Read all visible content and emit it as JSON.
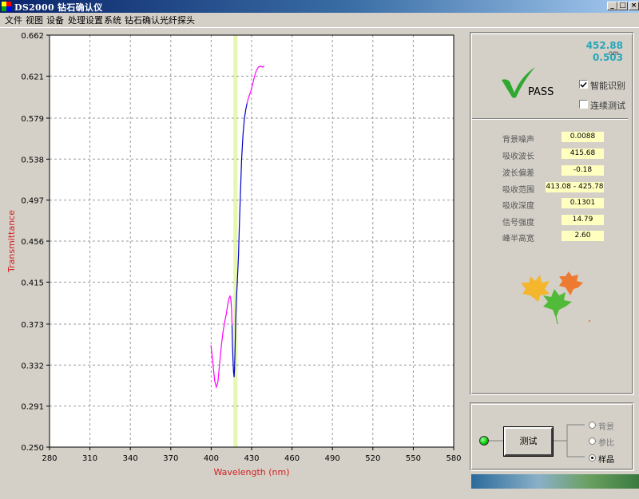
{
  "window": {
    "title": "DS2000 钻石确认仪",
    "controls": [
      "_",
      "□",
      "×"
    ]
  },
  "menu": [
    "文件",
    "视图",
    "设备",
    "处理设置",
    "系统",
    "钻石确认",
    "光纤探头"
  ],
  "chart_data": {
    "type": "line",
    "xlabel": "Wavelength (nm)",
    "ylabel": "Transmittance",
    "xlim": [
      280,
      580
    ],
    "ylim": [
      0.25,
      0.662
    ],
    "x_ticks": [
      "280",
      "310",
      "340",
      "370",
      "400",
      "430",
      "460",
      "490",
      "520",
      "550",
      "580"
    ],
    "y_ticks": [
      "0.662",
      "0.621",
      "0.579",
      "0.538",
      "0.497",
      "0.456",
      "0.415",
      "0.373",
      "0.332",
      "0.291",
      "0.250"
    ],
    "grid": true,
    "highlight_band": [
      416.5,
      419.5
    ],
    "series": [
      {
        "color": "#ff00ff",
        "points": [
          [
            399.8,
            0.352
          ],
          [
            401.2,
            0.335
          ],
          [
            402.6,
            0.316
          ],
          [
            403.8,
            0.31
          ],
          [
            405,
            0.315
          ],
          [
            406.2,
            0.333
          ],
          [
            407.6,
            0.352
          ],
          [
            408.8,
            0.365
          ],
          [
            410,
            0.375
          ],
          [
            411.2,
            0.383
          ],
          [
            412.2,
            0.392
          ],
          [
            413.2,
            0.399
          ],
          [
            414,
            0.401
          ],
          [
            414.6,
            0.398
          ],
          [
            415.1,
            0.388
          ],
          [
            415.5,
            0.372
          ]
        ]
      },
      {
        "color": "#0000cc",
        "points": [
          [
            415.5,
            0.372
          ],
          [
            415.8,
            0.353
          ],
          [
            416.2,
            0.337
          ],
          [
            416.6,
            0.325
          ],
          [
            417,
            0.32
          ],
          [
            417.4,
            0.33
          ],
          [
            417.8,
            0.352
          ],
          [
            418.2,
            0.38
          ],
          [
            418.8,
            0.4
          ],
          [
            419.4,
            0.415
          ],
          [
            420.2,
            0.44
          ],
          [
            421,
            0.475
          ],
          [
            421.8,
            0.508
          ],
          [
            422.6,
            0.538
          ],
          [
            423.6,
            0.562
          ],
          [
            424.6,
            0.578
          ],
          [
            425.6,
            0.587
          ],
          [
            426.6,
            0.594
          ]
        ]
      },
      {
        "color": "#ff00ff",
        "points": [
          [
            426.6,
            0.594
          ],
          [
            427.8,
            0.6
          ],
          [
            429.2,
            0.605
          ],
          [
            430.6,
            0.612
          ],
          [
            432,
            0.62
          ],
          [
            433.4,
            0.626
          ],
          [
            435,
            0.63
          ],
          [
            436.6,
            0.631
          ],
          [
            438.2,
            0.63
          ],
          [
            439.4,
            0.631
          ]
        ]
      }
    ]
  },
  "readout": {
    "wavelength": "452.88",
    "unit": "nm",
    "transmittance": "0.503"
  },
  "result": {
    "status": "PASS",
    "check_color": "#2ea82e"
  },
  "options": {
    "smart_identify": {
      "label": "智能识别",
      "checked": true
    },
    "continuous_test": {
      "label": "连续测试",
      "checked": false
    }
  },
  "params": [
    {
      "label": "背景噪声",
      "value": "0.0088"
    },
    {
      "label": "吸收波长",
      "value": "415.68"
    },
    {
      "label": "波长偏差",
      "value": "-0.18"
    },
    {
      "label": "吸收范围",
      "value": "413.08 - 425.78"
    },
    {
      "label": "吸收深度",
      "value": "0.1301"
    },
    {
      "label": "信号强度",
      "value": "14.79"
    },
    {
      "label": "峰半高宽",
      "value": "2.60"
    }
  ],
  "controls": {
    "test_button": "测试",
    "led_color": "#00cc00",
    "modes": [
      {
        "label": "背景",
        "selected": false
      },
      {
        "label": "参比",
        "selected": false
      },
      {
        "label": "样品",
        "selected": true
      }
    ]
  }
}
